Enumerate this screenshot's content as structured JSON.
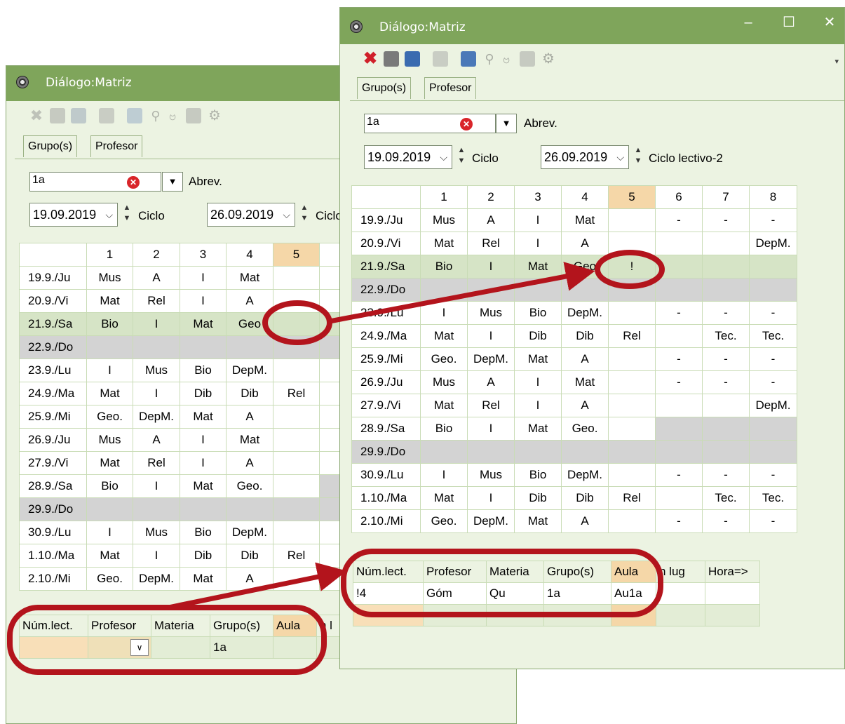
{
  "back": {
    "title": "Diálogo:Matriz",
    "tabs": [
      "Grupo(s)",
      "Profesor"
    ],
    "class_value": "1a",
    "abrev_label": "Abrev.",
    "date1": "19.09.2019",
    "label1": "Ciclo",
    "date2": "26.09.2019",
    "label2": "Ciclo",
    "hours": [
      "1",
      "2",
      "3",
      "4",
      "5"
    ],
    "rows": [
      {
        "day": "19.9./Ju",
        "c": [
          "Mus",
          "A",
          "I",
          "Mat",
          ""
        ]
      },
      {
        "day": "20.9./Vi",
        "c": [
          "Mat",
          "Rel",
          "I",
          "A",
          ""
        ]
      },
      {
        "day": "21.9./Sa",
        "c": [
          "Bio",
          "I",
          "Mat",
          "Geo",
          ""
        ]
      },
      {
        "day": "22.9./Do",
        "c": [
          "",
          "",
          "",
          "",
          ""
        ]
      },
      {
        "day": "23.9./Lu",
        "c": [
          "I",
          "Mus",
          "Bio",
          "DepM.",
          ""
        ]
      },
      {
        "day": "24.9./Ma",
        "c": [
          "Mat",
          "I",
          "Dib",
          "Dib",
          "Rel"
        ]
      },
      {
        "day": "25.9./Mi",
        "c": [
          "Geo.",
          "DepM.",
          "Mat",
          "A",
          ""
        ]
      },
      {
        "day": "26.9./Ju",
        "c": [
          "Mus",
          "A",
          "I",
          "Mat",
          ""
        ]
      },
      {
        "day": "27.9./Vi",
        "c": [
          "Mat",
          "Rel",
          "I",
          "A",
          ""
        ]
      },
      {
        "day": "28.9./Sa",
        "c": [
          "Bio",
          "I",
          "Mat",
          "Geo.",
          ""
        ]
      },
      {
        "day": "29.9./Do",
        "c": [
          "",
          "",
          "",
          "",
          ""
        ]
      },
      {
        "day": "30.9./Lu",
        "c": [
          "I",
          "Mus",
          "Bio",
          "DepM.",
          ""
        ]
      },
      {
        "day": "1.10./Ma",
        "c": [
          "Mat",
          "I",
          "Dib",
          "Dib",
          "Rel"
        ]
      },
      {
        "day": "2.10./Mi",
        "c": [
          "Geo.",
          "DepM.",
          "Mat",
          "A",
          ""
        ]
      }
    ],
    "lesson_headers": [
      "Núm.lect.",
      "Profesor",
      "Materia",
      "Grupo(s)",
      "Aula",
      "n l"
    ],
    "lesson_row": [
      "",
      "",
      "",
      "1a",
      "",
      ""
    ]
  },
  "front": {
    "title": "Diálogo:Matriz",
    "tabs": [
      "Grupo(s)",
      "Profesor"
    ],
    "class_value": "1a",
    "abrev_label": "Abrev.",
    "date1": "19.09.2019",
    "label1": "Ciclo",
    "date2": "26.09.2019",
    "label2": "Ciclo lectivo-2",
    "hours": [
      "1",
      "2",
      "3",
      "4",
      "5",
      "6",
      "7",
      "8"
    ],
    "rows": [
      {
        "day": "19.9./Ju",
        "c": [
          "Mus",
          "A",
          "I",
          "Mat",
          "",
          "-",
          "-",
          "-"
        ]
      },
      {
        "day": "20.9./Vi",
        "c": [
          "Mat",
          "Rel",
          "I",
          "A",
          "",
          "",
          "",
          "DepM."
        ]
      },
      {
        "day": "21.9./Sa",
        "c": [
          "Bio",
          "I",
          "Mat",
          "Geo",
          "!",
          "",
          "",
          ""
        ]
      },
      {
        "day": "22.9./Do",
        "c": [
          "",
          "",
          "",
          "",
          "",
          "",
          "",
          ""
        ]
      },
      {
        "day": "23.9./Lu",
        "c": [
          "I",
          "Mus",
          "Bio",
          "DepM.",
          "",
          "-",
          "-",
          "-"
        ]
      },
      {
        "day": "24.9./Ma",
        "c": [
          "Mat",
          "I",
          "Dib",
          "Dib",
          "Rel",
          "",
          "Tec.",
          "Tec."
        ]
      },
      {
        "day": "25.9./Mi",
        "c": [
          "Geo.",
          "DepM.",
          "Mat",
          "A",
          "",
          "-",
          "-",
          "-"
        ]
      },
      {
        "day": "26.9./Ju",
        "c": [
          "Mus",
          "A",
          "I",
          "Mat",
          "",
          "-",
          "-",
          "-"
        ]
      },
      {
        "day": "27.9./Vi",
        "c": [
          "Mat",
          "Rel",
          "I",
          "A",
          "",
          "",
          "",
          "DepM."
        ]
      },
      {
        "day": "28.9./Sa",
        "c": [
          "Bio",
          "I",
          "Mat",
          "Geo.",
          "",
          "",
          "",
          ""
        ]
      },
      {
        "day": "29.9./Do",
        "c": [
          "",
          "",
          "",
          "",
          "",
          "",
          "",
          ""
        ]
      },
      {
        "day": "30.9./Lu",
        "c": [
          "I",
          "Mus",
          "Bio",
          "DepM.",
          "",
          "-",
          "-",
          "-"
        ]
      },
      {
        "day": "1.10./Ma",
        "c": [
          "Mat",
          "I",
          "Dib",
          "Dib",
          "Rel",
          "",
          "Tec.",
          "Tec."
        ]
      },
      {
        "day": "2.10./Mi",
        "c": [
          "Geo.",
          "DepM.",
          "Mat",
          "A",
          "",
          "-",
          "-",
          "-"
        ]
      }
    ],
    "lesson_headers": [
      "Núm.lect.",
      "Profesor",
      "Materia",
      "Grupo(s)",
      "Aula",
      "n lug",
      "Hora=>"
    ],
    "lesson_row": [
      "!4",
      "Góm",
      "Qu",
      "1a",
      "Au1a",
      "",
      ""
    ]
  },
  "colors": {
    "titlebar": "#7fa55b",
    "annotation": "#b3141c",
    "selection_cell": "#f3b77a"
  }
}
